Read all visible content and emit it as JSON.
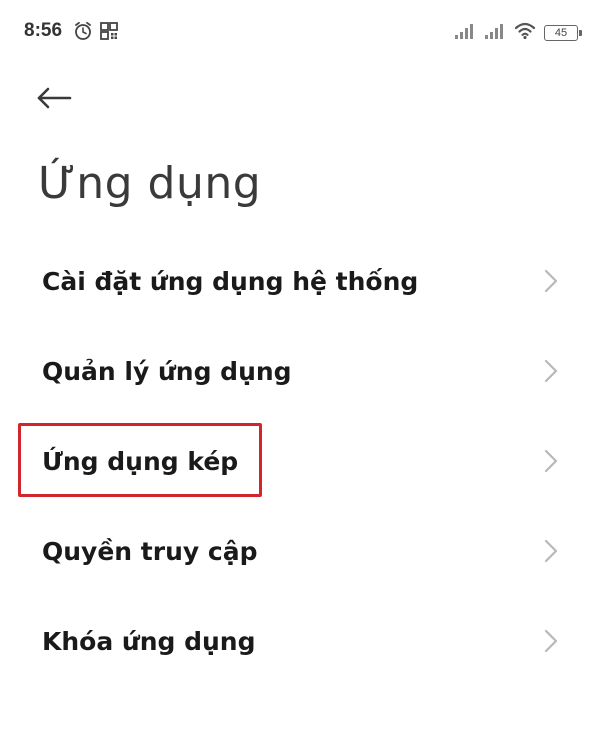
{
  "status_bar": {
    "time": "8:56",
    "battery": "45",
    "left_icons": [
      "alarm-icon",
      "qr-icon"
    ],
    "right_icons": [
      "signal-icon",
      "signal-icon",
      "wifi-icon",
      "battery-icon"
    ]
  },
  "header": {
    "back_icon": "arrow-left-icon",
    "title": "Ứng dụng"
  },
  "menu": {
    "items": [
      {
        "label": "Cài đặt ứng dụng hệ thống",
        "icon": "chevron-right-icon"
      },
      {
        "label": "Quản lý ứng dụng",
        "icon": "chevron-right-icon"
      },
      {
        "label": "Ứng dụng kép",
        "icon": "chevron-right-icon",
        "highlighted": true
      },
      {
        "label": "Quyền truy cập",
        "icon": "chevron-right-icon"
      },
      {
        "label": "Khóa ứng dụng",
        "icon": "chevron-right-icon"
      }
    ]
  },
  "colors": {
    "highlight": "#d3262c",
    "text": "#1a1a1a",
    "title": "#3a3a3a",
    "chevron": "#b8b8b8"
  }
}
